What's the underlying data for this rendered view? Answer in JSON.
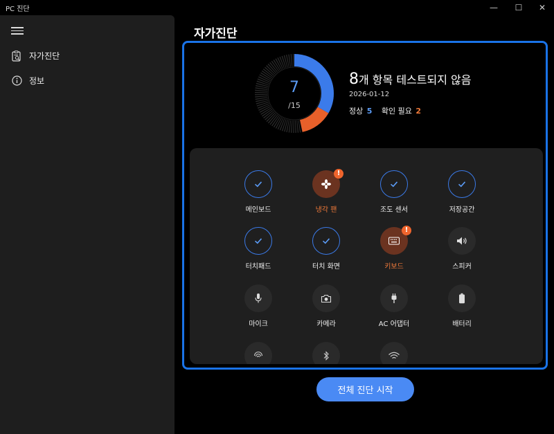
{
  "window": {
    "title": "PC 진단",
    "minimize_glyph": "—",
    "maximize_glyph": "☐",
    "close_glyph": "✕"
  },
  "sidebar": {
    "menu_icon": "hamburger-icon",
    "items": [
      {
        "label": "자가진단",
        "icon": "clipboard-search-icon"
      },
      {
        "label": "정보",
        "icon": "info-icon"
      }
    ]
  },
  "main": {
    "title": "자가진단",
    "score": {
      "tested": "7",
      "total_label": "/15",
      "normal_fraction": 0.333,
      "warning_fraction": 0.133
    },
    "summary": {
      "untested_count": "8",
      "untested_text": "개 항목 테스트되지 않음",
      "date": "2026-01-12",
      "normal_label": "정상",
      "normal_count": "5",
      "warning_label": "확인 필요",
      "warning_count": "2"
    },
    "tiles": [
      {
        "label": "메인보드",
        "status": "ok",
        "icon": "check-icon"
      },
      {
        "label": "냉각 팬",
        "status": "warn",
        "icon": "fan-icon"
      },
      {
        "label": "조도 센서",
        "status": "ok",
        "icon": "check-icon"
      },
      {
        "label": "저장공간",
        "status": "ok",
        "icon": "check-icon"
      },
      {
        "label": "터치패드",
        "status": "ok",
        "icon": "check-icon"
      },
      {
        "label": "터치 화면",
        "status": "ok",
        "icon": "check-icon"
      },
      {
        "label": "키보드",
        "status": "warn",
        "icon": "keyboard-icon"
      },
      {
        "label": "스피커",
        "status": "idle",
        "icon": "speaker-icon"
      },
      {
        "label": "마이크",
        "status": "idle",
        "icon": "microphone-icon"
      },
      {
        "label": "카메라",
        "status": "idle",
        "icon": "camera-icon"
      },
      {
        "label": "AC 어댑터",
        "status": "idle",
        "icon": "plug-icon"
      },
      {
        "label": "배터리",
        "status": "idle",
        "icon": "battery-icon"
      },
      {
        "label": "",
        "status": "idle",
        "icon": "fingerprint-icon"
      },
      {
        "label": "",
        "status": "idle",
        "icon": "bluetooth-icon"
      },
      {
        "label": "",
        "status": "idle",
        "icon": "wifi-icon"
      }
    ],
    "start_button": "전체 진단 시작"
  },
  "colors": {
    "accent": "#1a73e8",
    "ok": "#4a8af4",
    "warning": "#f0652d",
    "panel": "#1f1f1f",
    "sidebar": "#1e1e1e"
  }
}
